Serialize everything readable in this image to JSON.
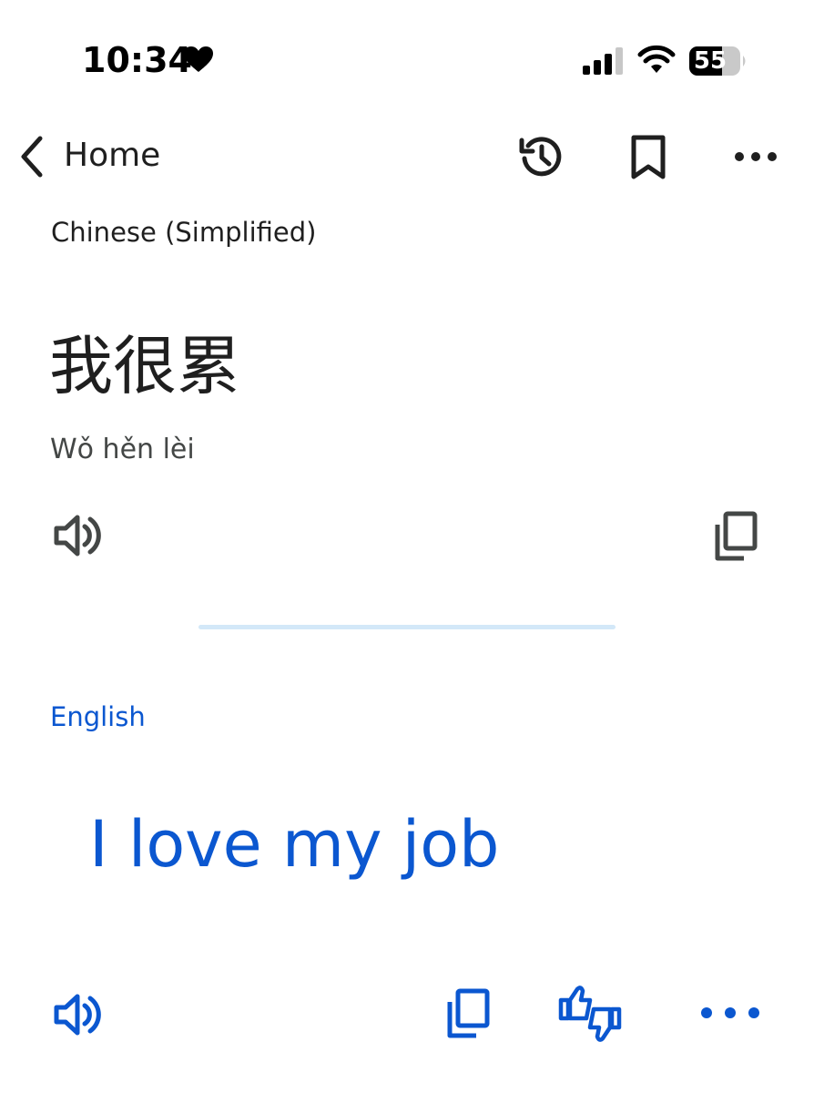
{
  "status_bar": {
    "time": "10:34",
    "battery": "55",
    "icons": [
      "heart-icon",
      "signal-icon",
      "wifi-icon",
      "battery-icon"
    ]
  },
  "app_bar": {
    "back_label": "Home",
    "icons": [
      "back-chevron-icon",
      "history-icon",
      "bookmark-icon",
      "more-options-icon"
    ]
  },
  "source": {
    "language": "Chinese (Simplified)",
    "text": "我很累",
    "romanization": "Wǒ hěn lèi",
    "icons": [
      "speaker-icon",
      "copy-icon"
    ]
  },
  "target": {
    "language": "English",
    "text": "I love my job",
    "icons": [
      "speaker-icon",
      "copy-icon",
      "thumbs-feedback-icon",
      "more-options-icon"
    ]
  },
  "colors": {
    "accent": "#0b57d0",
    "text": "#1f1f1f",
    "secondary_text": "#444746",
    "divider": "#d3e8f8"
  }
}
